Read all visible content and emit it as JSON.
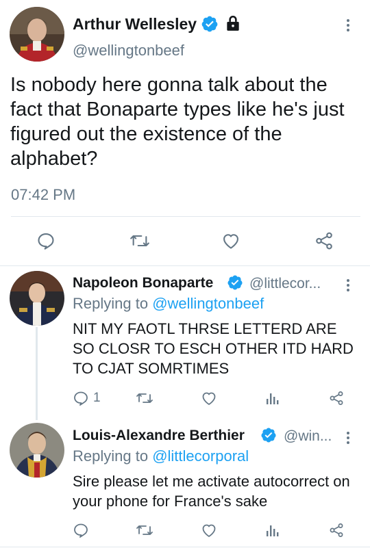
{
  "main_tweet": {
    "author_name": "Arthur Wellesley",
    "handle": "@wellingtonbeef",
    "text": "Is nobody here gonna talk about the fact that Bonaparte types like he's just figured out the existence of the alphabet?",
    "time": "07:42 PM",
    "verified": true,
    "protected": true
  },
  "replies": [
    {
      "author_name": "Napoleon Bonaparte",
      "handle": "@littlecor...",
      "replying_label": "Replying to",
      "replying_to": "@wellingtonbeef",
      "text": "NIT MY FAOTL THRSE LETTERD ARE SO CLOSR TO ESCH OTHER ITD HARD TO CJAT SOMRTIMES",
      "reply_count": "1",
      "verified": true
    },
    {
      "author_name": "Louis-Alexandre Berthier",
      "handle": "@win...",
      "replying_label": "Replying to",
      "replying_to": "@littlecorporal",
      "text": "Sire please let me activate autocorrect on your phone for France's sake",
      "reply_count": "",
      "verified": true
    }
  ],
  "colors": {
    "accent": "#1da1f2",
    "secondary_text": "#657786",
    "icon": "#657786",
    "divider": "#e1e8ed"
  }
}
